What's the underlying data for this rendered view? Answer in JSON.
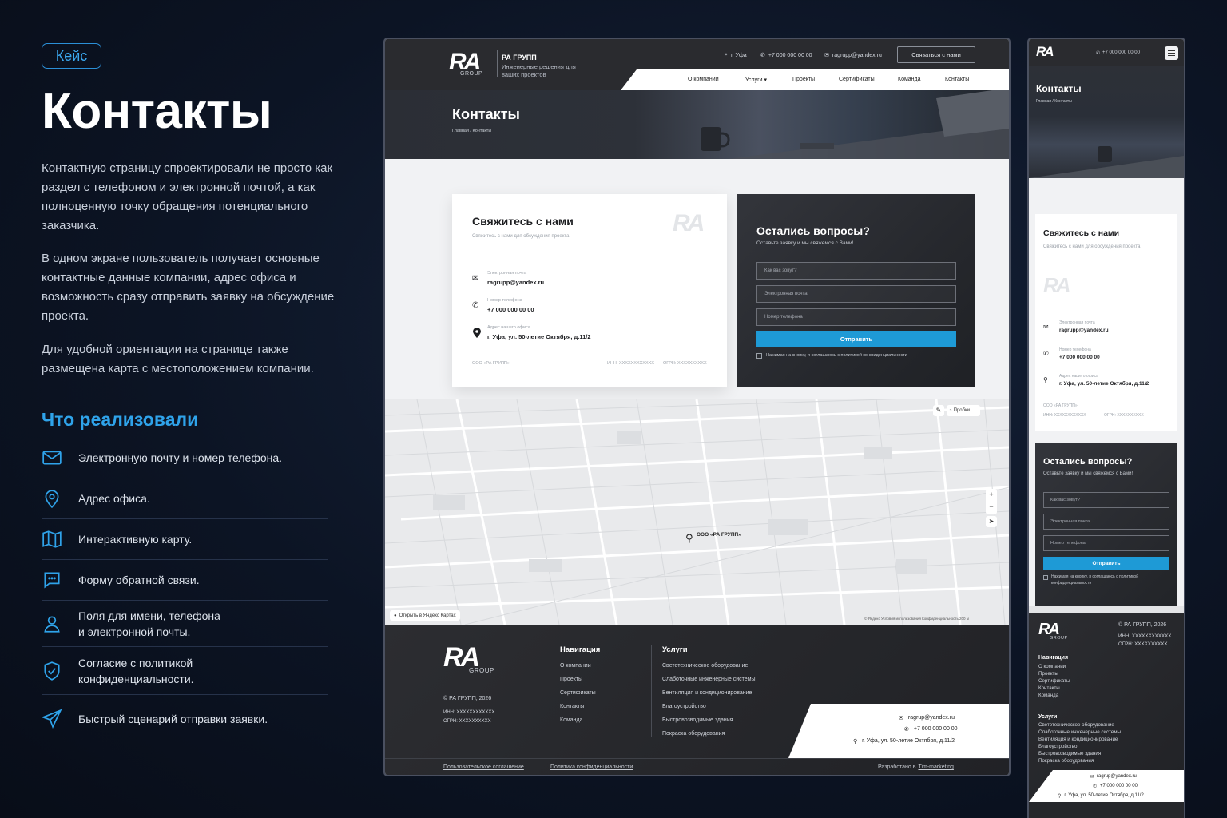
{
  "left": {
    "badge": "Кейс",
    "title": "Контакты",
    "paragraphs": [
      "Контактную страницу спроектировали не просто как раздел с телефоном и электронной почтой, а как полноценную точку обращения потенциального заказчика.",
      "В одном экране пользователь получает основные контактные данные компании, адрес офиса и возможность сразу отправить заявку на обсуждение проекта.",
      "Для удобной ориентации на странице также размещена карта с местоположением компании."
    ],
    "section_title": "Что реализовали",
    "features": [
      {
        "icon": "envelope-icon",
        "text": "Электронную почту и номер телефона."
      },
      {
        "icon": "map-pin-icon",
        "text": "Адрес офиса."
      },
      {
        "icon": "map-icon",
        "text": "Интерактивную карту."
      },
      {
        "icon": "chat-icon",
        "text": "Форму обратной связи."
      },
      {
        "icon": "user-icon",
        "text": "Поля для имени, телефона\nи электронной почты."
      },
      {
        "icon": "shield-check-icon",
        "text": "Согласие с политикой\nконфиденциальности."
      },
      {
        "icon": "send-icon",
        "text": "Быстрый сценарий отправки заявки."
      }
    ]
  },
  "desktop": {
    "header": {
      "logo": "RA",
      "logo_sub": "GROUP",
      "brand": "РА ГРУПП",
      "tagline": "Инженерные решения для ваших проектов",
      "city": "г. Уфа",
      "phone": "+7 000 000 00 00",
      "email": "ragrupp@yandex.ru",
      "cta": "Связаться с нами"
    },
    "nav": [
      "О компании",
      "Услуги ▾",
      "Проекты",
      "Сертификаты",
      "Команда",
      "Контакты"
    ],
    "hero": {
      "title": "Контакты",
      "crumb": "Главная  /  Контакты"
    },
    "contact_card": {
      "title": "Свяжитесь с нами",
      "subtitle": "Свяжитесь с нами для обсуждения проекта",
      "email_label": "Электронная почта",
      "email": "ragrupp@yandex.ru",
      "phone_label": "Номер телефона",
      "phone": "+7 000 000 00 00",
      "address_label": "Адрес нашего офиса",
      "address": "г. Уфа, ул. 50-летие Октября, д.11/2",
      "company": "ООО «РА ГРУПП»",
      "inn": "ИНН: XXXXXXXXXXXX",
      "ogrn": "ОГРН: XXXXXXXXXX"
    },
    "form": {
      "title": "Остались вопросы?",
      "subtitle": "Оставьте заявку и мы свяжемся с Вами!",
      "name_placeholder": "Как вас зовут?",
      "email_placeholder": "Электронная почта",
      "phone_placeholder": "Номер телефона",
      "submit": "Отправить",
      "consent": "Нажимая на кнопку, я соглашаюсь с политикой конфиденциальности"
    },
    "map": {
      "marker": "ООО «РА ГРУПП»",
      "traffic": "Пробки",
      "open": "Открыть в Яндекс Картах",
      "footer_note": "© Яндекс  Условия использования  Конфиденциальность   200 м"
    },
    "footer": {
      "copyright": "© РА ГРУПП, 2026",
      "inn": "ИНН: XXXXXXXXXXXX",
      "ogrn": "ОГРН: XXXXXXXXXX",
      "nav_title": "Навигация",
      "nav_items": [
        "О компании",
        "Проекты",
        "Сертификаты",
        "Контакты",
        "Команда"
      ],
      "services_title": "Услуги",
      "services_items": [
        "Светотехническое оборудование",
        "Слаботочные инженерные системы",
        "Вентиляция и кондиционирование",
        "Благоустройство",
        "Быстровозводимые здания",
        "Покраска оборудования"
      ],
      "email": "ragrup@yandex.ru",
      "phone": "+7 000 000 00 00",
      "address": "г. Уфа, ул. 50-летие Октября, д.11/2",
      "terms": "Пользовательское соглашение",
      "privacy": "Политика конфиденциальности",
      "dev_prefix": "Разработано в",
      "dev": "Tim-marketing"
    }
  },
  "mobile": {
    "phone": "+7 000 000 00 00",
    "hero_title": "Контакты",
    "crumb": "Главная  /  Контакты",
    "card_title": "Свяжитесь с нами",
    "card_sub": "Свяжитесь с нами для обсуждения проекта",
    "form_title": "Остались вопросы?",
    "form_sub": "Оставьте заявку и мы свяжемся с Вами!",
    "consent": "Нажимая на кнопку, я соглашаюсь с политикой конфиденциальности",
    "copyright": "© РА ГРУПП, 2026"
  },
  "colors": {
    "accent": "#2fa3ea",
    "button": "#1e9ad6",
    "dark": "#2a2b2f",
    "background": "#0c1424"
  }
}
